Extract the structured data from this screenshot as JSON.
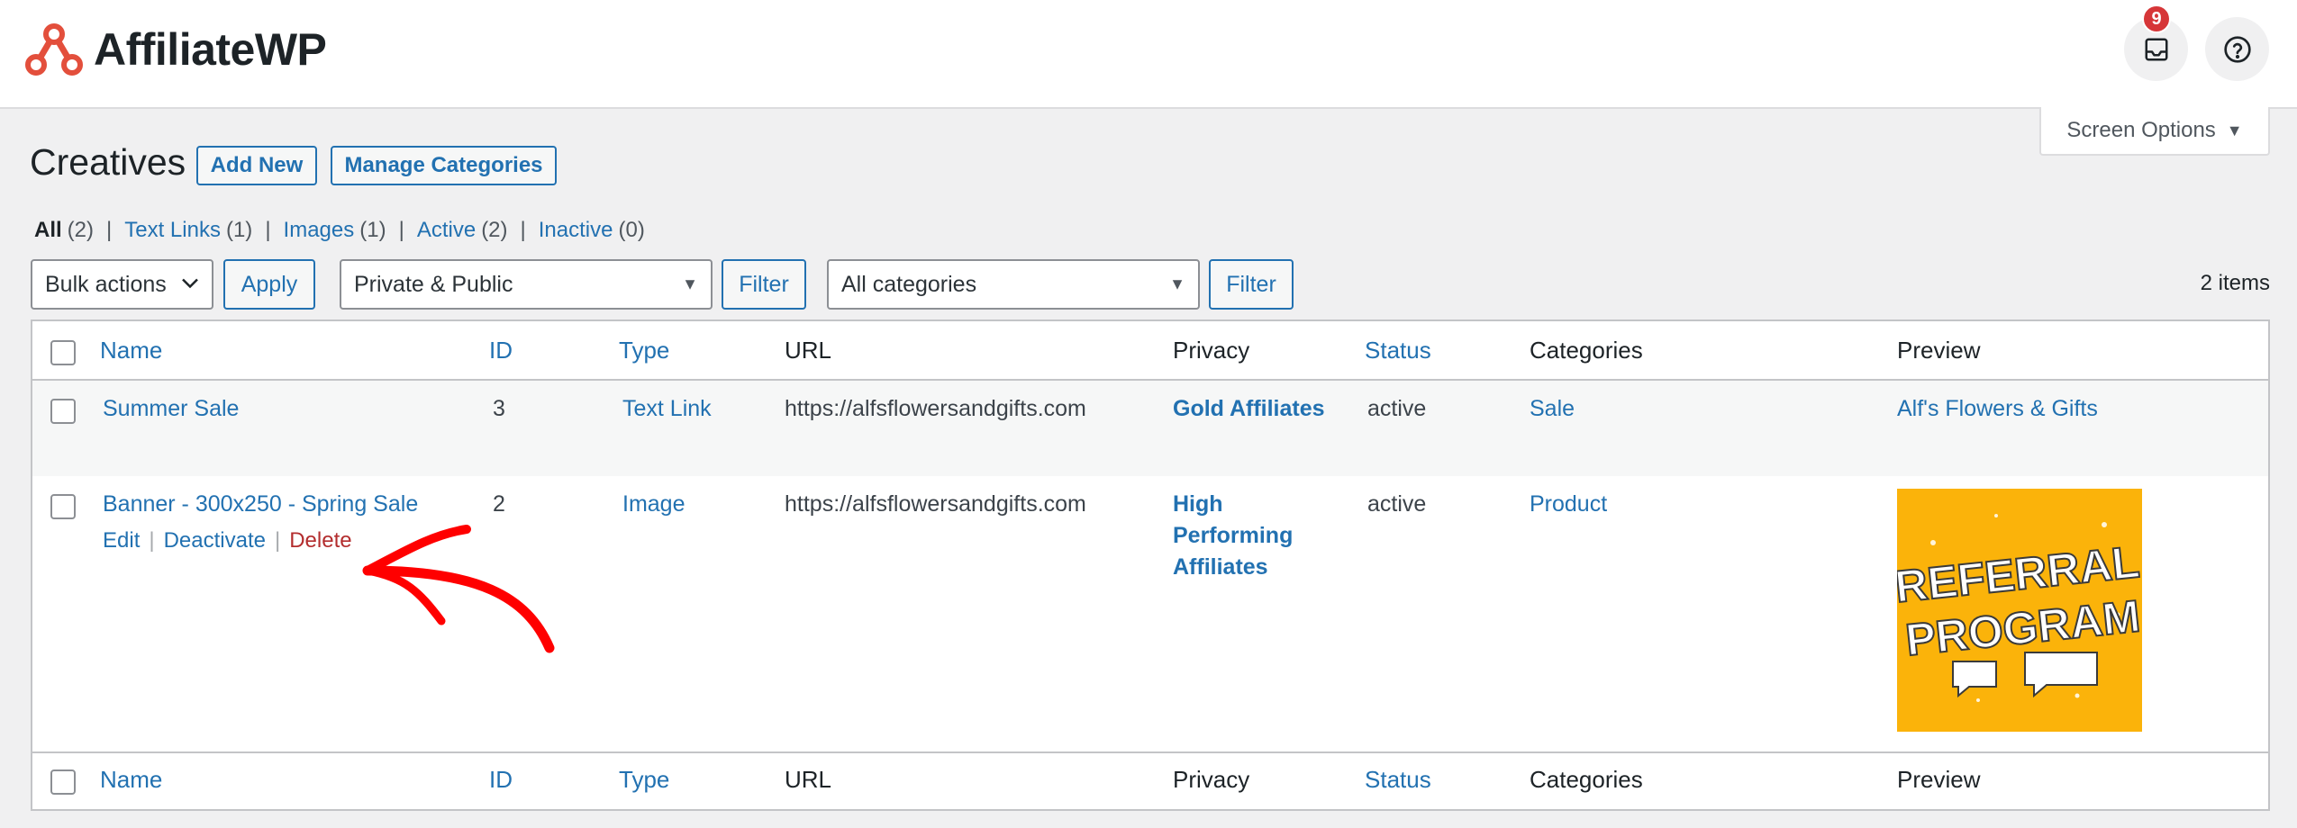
{
  "header": {
    "brand_name": "AffiliateWP",
    "notification_count": "9"
  },
  "screen_options": {
    "label": "Screen Options"
  },
  "page": {
    "title": "Creatives",
    "add_new_label": "Add New",
    "manage_categories_label": "Manage Categories"
  },
  "views": [
    {
      "label": "All",
      "count": "(2)",
      "current": true
    },
    {
      "label": "Text Links",
      "count": "(1)"
    },
    {
      "label": "Images",
      "count": "(1)"
    },
    {
      "label": "Active",
      "count": "(2)"
    },
    {
      "label": "Inactive",
      "count": "(0)"
    }
  ],
  "toolbar": {
    "bulk_actions": "Bulk actions",
    "apply_label": "Apply",
    "privacy_selected": "Private & Public",
    "filter_label": "Filter",
    "categories_selected": "All categories",
    "items_count": "2 items"
  },
  "table": {
    "columns": [
      "Name",
      "ID",
      "Type",
      "URL",
      "Privacy",
      "Status",
      "Categories",
      "Preview"
    ],
    "rows": [
      {
        "name": "Summer Sale",
        "id": "3",
        "type": "Text Link",
        "url": "https://alfsflowersandgifts.com",
        "privacy": "Gold Affiliates",
        "status": "active",
        "category": "Sale",
        "preview": "Alf's Flowers & Gifts"
      },
      {
        "name": "Banner - 300x250 - Spring Sale",
        "id": "2",
        "type": "Image",
        "url": "https://alfsflowersandgifts.com",
        "privacy_lines": [
          "High",
          "Performing",
          "Affiliates"
        ],
        "status": "active",
        "category": "Product",
        "preview_image_lines": [
          "REFERRAL",
          "PROGRAM"
        ],
        "actions": {
          "edit": "Edit",
          "deactivate": "Deactivate",
          "delete": "Delete"
        }
      }
    ]
  },
  "colors": {
    "accent": "#2271b1",
    "delete": "#b32d2e",
    "badge": "#d63638",
    "brand_logo": "#e34f3c",
    "annotation_arrow": "#ff0000",
    "preview_bg": "#fbb30a"
  }
}
